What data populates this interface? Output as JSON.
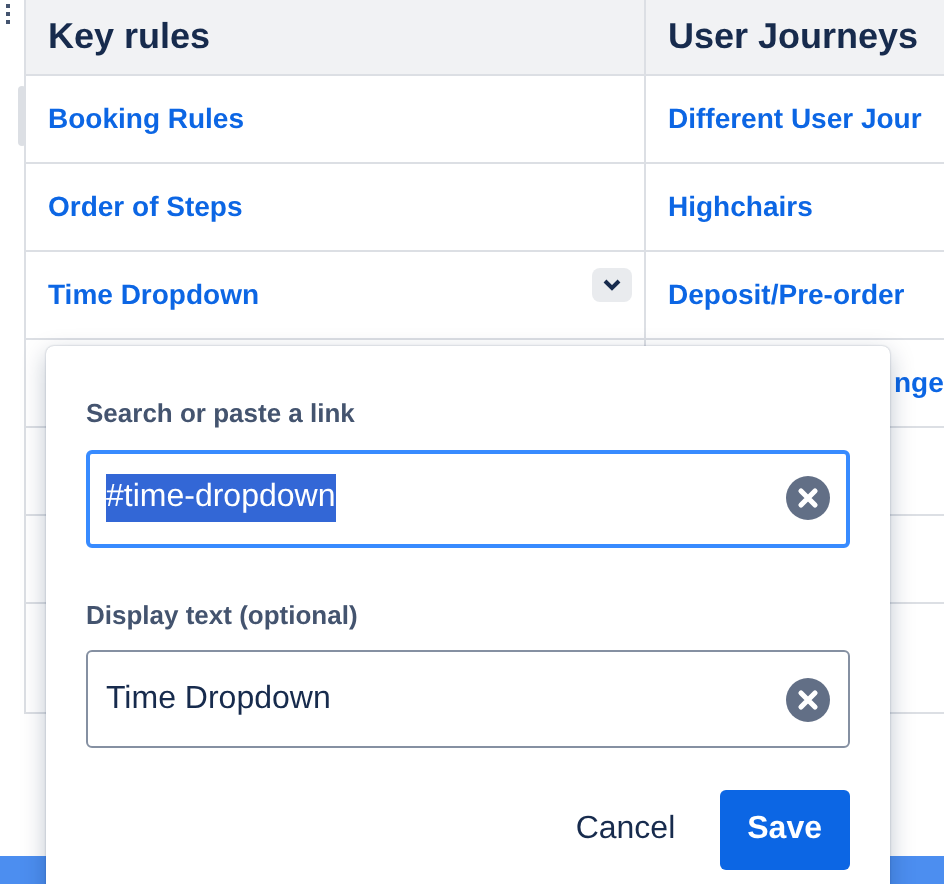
{
  "table": {
    "columns": [
      "Key rules",
      "User Journeys"
    ],
    "rows": [
      {
        "key_rule": "Booking Rules",
        "user_journey": "Different User Jour",
        "menu_button": false
      },
      {
        "key_rule": "Order of Steps",
        "user_journey": "Highchairs",
        "menu_button": false
      },
      {
        "key_rule": "Time Dropdown",
        "user_journey": "Deposit/Pre-order",
        "menu_button": true
      },
      {
        "user_journey": "nge"
      }
    ]
  },
  "link_dialog": {
    "fields": [
      {
        "label": "Search or paste a link",
        "value": "#time-dropdown",
        "focused": true,
        "text_selected": true
      },
      {
        "label": "Display text (optional)",
        "value": "Time Dropdown",
        "focused": false,
        "text_selected": false
      }
    ],
    "buttons": [
      {
        "label": "Cancel",
        "kind": "subtle"
      },
      {
        "label": "Save",
        "kind": "primary"
      }
    ]
  }
}
